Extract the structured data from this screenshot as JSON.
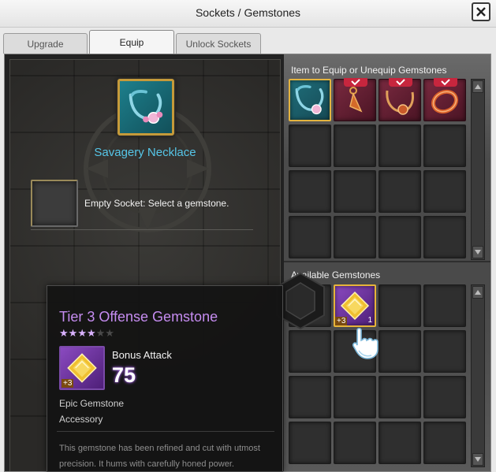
{
  "window": {
    "title": "Sockets / Gemstones"
  },
  "tabs": [
    {
      "label": "Upgrade"
    },
    {
      "label": "Equip"
    },
    {
      "label": "Unlock Sockets"
    }
  ],
  "equip": {
    "item_name": "Savagery Necklace",
    "socket_text": "Empty Socket: Select a gemstone."
  },
  "items_section": {
    "label": "Item to Equip or Unequip Gemstones"
  },
  "gems_section": {
    "label": "Available Gemstones"
  },
  "gem_slot": {
    "plus_badge": "+3",
    "count": "1"
  },
  "tooltip": {
    "title": "Tier 3 Offense Gemstone",
    "stars_filled": 4,
    "stars_total": 6,
    "stat_label": "Bonus Attack",
    "stat_value": "75",
    "plus_badge": "+3",
    "rarity": "Epic Gemstone",
    "category": "Accessory",
    "description": "This gemstone has been refined and cut with utmost precision. It hums with carefully honed power."
  },
  "colors": {
    "item_name": "#56c6e8",
    "tooltip_title": "#c58cf0",
    "stat_value": "#ffffff",
    "check_ribbon": "#c7263e",
    "gold_border": "#e3b33f"
  }
}
